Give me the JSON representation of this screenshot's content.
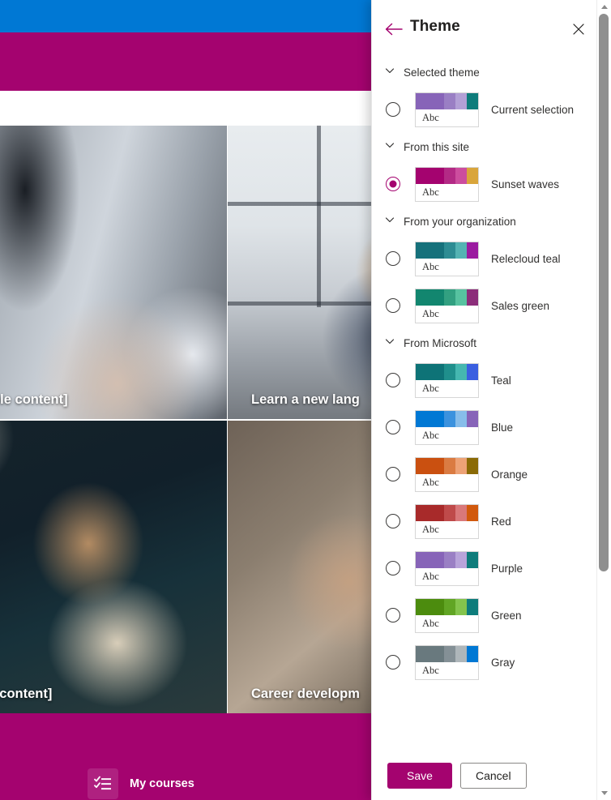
{
  "background": {
    "top_bar_color": "#0078d4",
    "brand_bar_color": "#a4036f",
    "cards": [
      {
        "caption": "s [Sample content]",
        "image": "handshake-photo"
      },
      {
        "caption": "Learn a new lang",
        "image": "office-meeting-photo"
      },
      {
        "caption": "Sample content]",
        "image": "woman-at-laptop-photo"
      },
      {
        "caption": "Career developm",
        "image": "hands-together-photo"
      }
    ],
    "footer": {
      "courses_label": "My courses",
      "courses_icon": "checklist-icon"
    }
  },
  "panel": {
    "title": "Theme",
    "back_icon": "back-arrow-icon",
    "close_icon": "close-icon",
    "accent_color": "#a4036f",
    "groups": [
      {
        "label": "Selected theme",
        "chevron_icon": "chevron-down-icon",
        "options": [
          {
            "label": "Current selection",
            "selected": false,
            "sample_text": "Abc",
            "colors": [
              "#8764b8",
              "#9a7fc4",
              "#b3a0d6",
              "#0e7c7b"
            ]
          }
        ]
      },
      {
        "label": "From this site",
        "chevron_icon": "chevron-down-icon",
        "options": [
          {
            "label": "Sunset waves",
            "selected": true,
            "sample_text": "Abc",
            "colors": [
              "#a4036f",
              "#b32a85",
              "#cc4d9e",
              "#d9a53b"
            ]
          }
        ]
      },
      {
        "label": "From your organization",
        "chevron_icon": "chevron-down-icon",
        "options": [
          {
            "label": "Relecloud teal",
            "selected": false,
            "sample_text": "Abc",
            "colors": [
              "#16717b",
              "#2d8c93",
              "#54b3b3",
              "#9b1ba0"
            ]
          },
          {
            "label": "Sales green",
            "selected": false,
            "sample_text": "Abc",
            "colors": [
              "#12866f",
              "#32a081",
              "#57c2a0",
              "#8c2d7a"
            ]
          }
        ]
      },
      {
        "label": "From Microsoft",
        "chevron_icon": "chevron-down-icon",
        "options": [
          {
            "label": "Teal",
            "selected": false,
            "sample_text": "Abc",
            "colors": [
              "#0e7377",
              "#1f8f8c",
              "#45b7b0",
              "#3a5fe0"
            ]
          },
          {
            "label": "Blue",
            "selected": false,
            "sample_text": "Abc",
            "colors": [
              "#0078d4",
              "#3b92de",
              "#87bdea",
              "#8764b8"
            ]
          },
          {
            "label": "Orange",
            "selected": false,
            "sample_text": "Abc",
            "colors": [
              "#ca5010",
              "#da7b42",
              "#eda276",
              "#8a6a06"
            ]
          },
          {
            "label": "Red",
            "selected": false,
            "sample_text": "Abc",
            "colors": [
              "#a82a2a",
              "#bf4a4a",
              "#d9787a",
              "#d1590d"
            ]
          },
          {
            "label": "Purple",
            "selected": false,
            "sample_text": "Abc",
            "colors": [
              "#8764b8",
              "#9a7fc4",
              "#b8a4da",
              "#0e7c7b"
            ]
          },
          {
            "label": "Green",
            "selected": false,
            "sample_text": "Abc",
            "colors": [
              "#4c8c0e",
              "#61a524",
              "#84c44c",
              "#0e7c7b"
            ]
          },
          {
            "label": "Gray",
            "selected": false,
            "sample_text": "Abc",
            "colors": [
              "#69797e",
              "#849096",
              "#aeb6ba",
              "#0078d4"
            ]
          }
        ]
      }
    ],
    "actions": {
      "save_label": "Save",
      "cancel_label": "Cancel"
    },
    "scrollbar": {
      "up_icon": "scroll-up-arrow-icon",
      "down_icon": "scroll-down-arrow-icon"
    }
  }
}
